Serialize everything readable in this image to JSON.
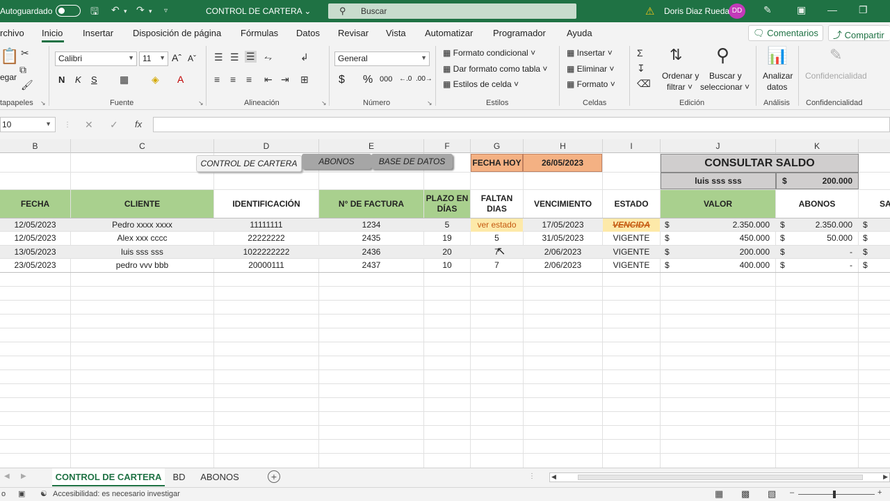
{
  "titlebar": {
    "autosave_label": "Autoguardado",
    "doc_title": "CONTROL DE CARTERA",
    "search_placeholder": "Buscar",
    "user_name": "Doris Diaz Rueda",
    "user_initials": "DD"
  },
  "menu": {
    "tabs": [
      "rchivo",
      "Inicio",
      "Insertar",
      "Disposición de página",
      "Fórmulas",
      "Datos",
      "Revisar",
      "Vista",
      "Automatizar",
      "Programador",
      "Ayuda"
    ],
    "comments_label": "Comentarios",
    "share_label": "Compartir"
  },
  "ribbon": {
    "groups": [
      "tapapeles",
      "Fuente",
      "Alineación",
      "Número",
      "Estilos",
      "Celdas",
      "Edición",
      "Análisis",
      "Confidencialidad"
    ],
    "paste_label": "egar",
    "font_name": "Calibri",
    "font_size": "11",
    "number_format": "General",
    "styles": [
      "Formato condicional",
      "Dar formato como tabla",
      "Estilos de celda"
    ],
    "cells": [
      "Insertar",
      "Eliminar",
      "Formato"
    ],
    "edit_sort": [
      "Ordenar y",
      "filtrar"
    ],
    "edit_find": [
      "Buscar y",
      "seleccionar"
    ],
    "analyze": [
      "Analizar",
      "datos"
    ],
    "confidentiality_btn": "Confidencialidad"
  },
  "formula": {
    "namebox": "10",
    "fx": "fx"
  },
  "columns": [
    "B",
    "C",
    "D",
    "E",
    "F",
    "G",
    "H",
    "I",
    "J",
    "K"
  ],
  "nav_buttons": [
    "CONTROL DE CARTERA",
    "ABONOS",
    "BASE DE DATOS"
  ],
  "fecha_hoy": {
    "label": "FECHA HOY",
    "value": "26/05/2023"
  },
  "consulta": {
    "title": "CONSULTAR SALDO",
    "client": "luis sss sss",
    "currency": "$",
    "amount": "200.000"
  },
  "headers": [
    "FECHA",
    "CLIENTE",
    "IDENTIFICACIÓN",
    "N° DE FACTURA",
    "PLAZO EN DÍAS",
    "FALTAN DIAS",
    "VENCIMIENTO",
    "ESTADO",
    "VALOR",
    "ABONOS",
    "SA"
  ],
  "rows": [
    {
      "fecha": "12/05/2023",
      "cliente": "Pedro xxxx xxxx",
      "id": "11111111",
      "factura": "1234",
      "plazo": "5",
      "faltan": "ver estado",
      "venc": "17/05/2023",
      "estado": "VENCIDA",
      "valor_cur": "$",
      "valor": "2.350.000",
      "abono_cur": "$",
      "abono": "2.350.000",
      "saldo_cur": "$"
    },
    {
      "fecha": "12/05/2023",
      "cliente": "Alex xxx cccc",
      "id": "22222222",
      "factura": "2435",
      "plazo": "19",
      "faltan": "5",
      "venc": "31/05/2023",
      "estado": "VIGENTE",
      "valor_cur": "$",
      "valor": "450.000",
      "abono_cur": "$",
      "abono": "50.000",
      "saldo_cur": "$"
    },
    {
      "fecha": "13/05/2023",
      "cliente": "luis sss sss",
      "id": "1022222222",
      "factura": "2436",
      "plazo": "20",
      "faltan": "7",
      "venc": "2/06/2023",
      "estado": "VIGENTE",
      "valor_cur": "$",
      "valor": "200.000",
      "abono_cur": "$",
      "abono": "-",
      "saldo_cur": "$"
    },
    {
      "fecha": "23/05/2023",
      "cliente": "pedro vvv bbb",
      "id": "20000111",
      "factura": "2437",
      "plazo": "10",
      "faltan": "7",
      "venc": "2/06/2023",
      "estado": "VIGENTE",
      "valor_cur": "$",
      "valor": "400.000",
      "abono_cur": "$",
      "abono": "-",
      "saldo_cur": "$"
    }
  ],
  "sheets": [
    "CONTROL DE CARTERA",
    "BD",
    "ABONOS"
  ],
  "status": {
    "left": "o",
    "accessibility": "Accesibilidad: es necesario investigar"
  },
  "colors": {
    "accent": "#1f7244",
    "header_green": "#a9d08e",
    "header_orange": "#f4b183",
    "header_gray": "#d0cece",
    "expired_text": "#c55a11"
  }
}
